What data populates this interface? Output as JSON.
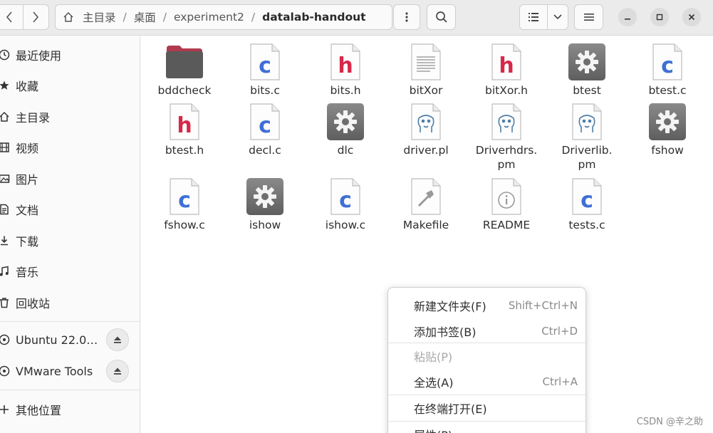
{
  "header": {
    "path": [
      "主目录",
      "桌面",
      "experiment2",
      "datalab-handout"
    ]
  },
  "sidebar": {
    "items": [
      {
        "label": "最近使用",
        "icon": "clock-icon"
      },
      {
        "label": "收藏",
        "icon": "star-icon"
      },
      {
        "label": "主目录",
        "icon": "home-icon"
      },
      {
        "label": "视频",
        "icon": "film-icon"
      },
      {
        "label": "图片",
        "icon": "image-icon"
      },
      {
        "label": "文档",
        "icon": "document-icon"
      },
      {
        "label": "下载",
        "icon": "download-icon"
      },
      {
        "label": "音乐",
        "icon": "music-icon"
      },
      {
        "label": "回收站",
        "icon": "trash-icon"
      }
    ],
    "devices": [
      {
        "label": "Ubuntu 22.0…",
        "icon": "disc-icon"
      },
      {
        "label": "VMware Tools",
        "icon": "disc-icon"
      }
    ],
    "other": {
      "label": "其他位置",
      "icon": "plus-icon"
    }
  },
  "files": [
    {
      "name": "bddcheck",
      "type": "folder"
    },
    {
      "name": "bits.c",
      "type": "c"
    },
    {
      "name": "bits.h",
      "type": "h"
    },
    {
      "name": "bitXor",
      "type": "text"
    },
    {
      "name": "bitXor.h",
      "type": "h"
    },
    {
      "name": "btest",
      "type": "exec"
    },
    {
      "name": "btest.c",
      "type": "c"
    },
    {
      "name": "btest.h",
      "type": "h"
    },
    {
      "name": "decl.c",
      "type": "c"
    },
    {
      "name": "dlc",
      "type": "exec"
    },
    {
      "name": "driver.pl",
      "type": "perl"
    },
    {
      "name": "Driverhdrs.\npm",
      "type": "perl"
    },
    {
      "name": "Driverlib.\npm",
      "type": "perl"
    },
    {
      "name": "fshow",
      "type": "exec"
    },
    {
      "name": "fshow.c",
      "type": "c"
    },
    {
      "name": "ishow",
      "type": "exec"
    },
    {
      "name": "ishow.c",
      "type": "c"
    },
    {
      "name": "Makefile",
      "type": "makefile"
    },
    {
      "name": "README",
      "type": "info"
    },
    {
      "name": "tests.c",
      "type": "c"
    }
  ],
  "context_menu": {
    "items": [
      {
        "label": "新建文件夹(F)",
        "accel": "Shift+Ctrl+N",
        "disabled": false
      },
      {
        "label": "添加书签(B)",
        "accel": "Ctrl+D",
        "disabled": false
      },
      {
        "label": "粘贴(P)",
        "accel": "",
        "disabled": true
      },
      {
        "label": "全选(A)",
        "accel": "Ctrl+A",
        "disabled": false
      },
      {
        "label": "在终端打开(E)",
        "accel": "",
        "disabled": false
      },
      {
        "label": "属性(P)",
        "accel": "",
        "disabled": false
      }
    ]
  },
  "watermark": "CSDN @辛之助",
  "colors": {
    "c_file_letter": "#3f6fd6",
    "h_file_letter": "#d6294a",
    "folder": "#5a5a5a",
    "folder_tab": "#b13a4e"
  }
}
